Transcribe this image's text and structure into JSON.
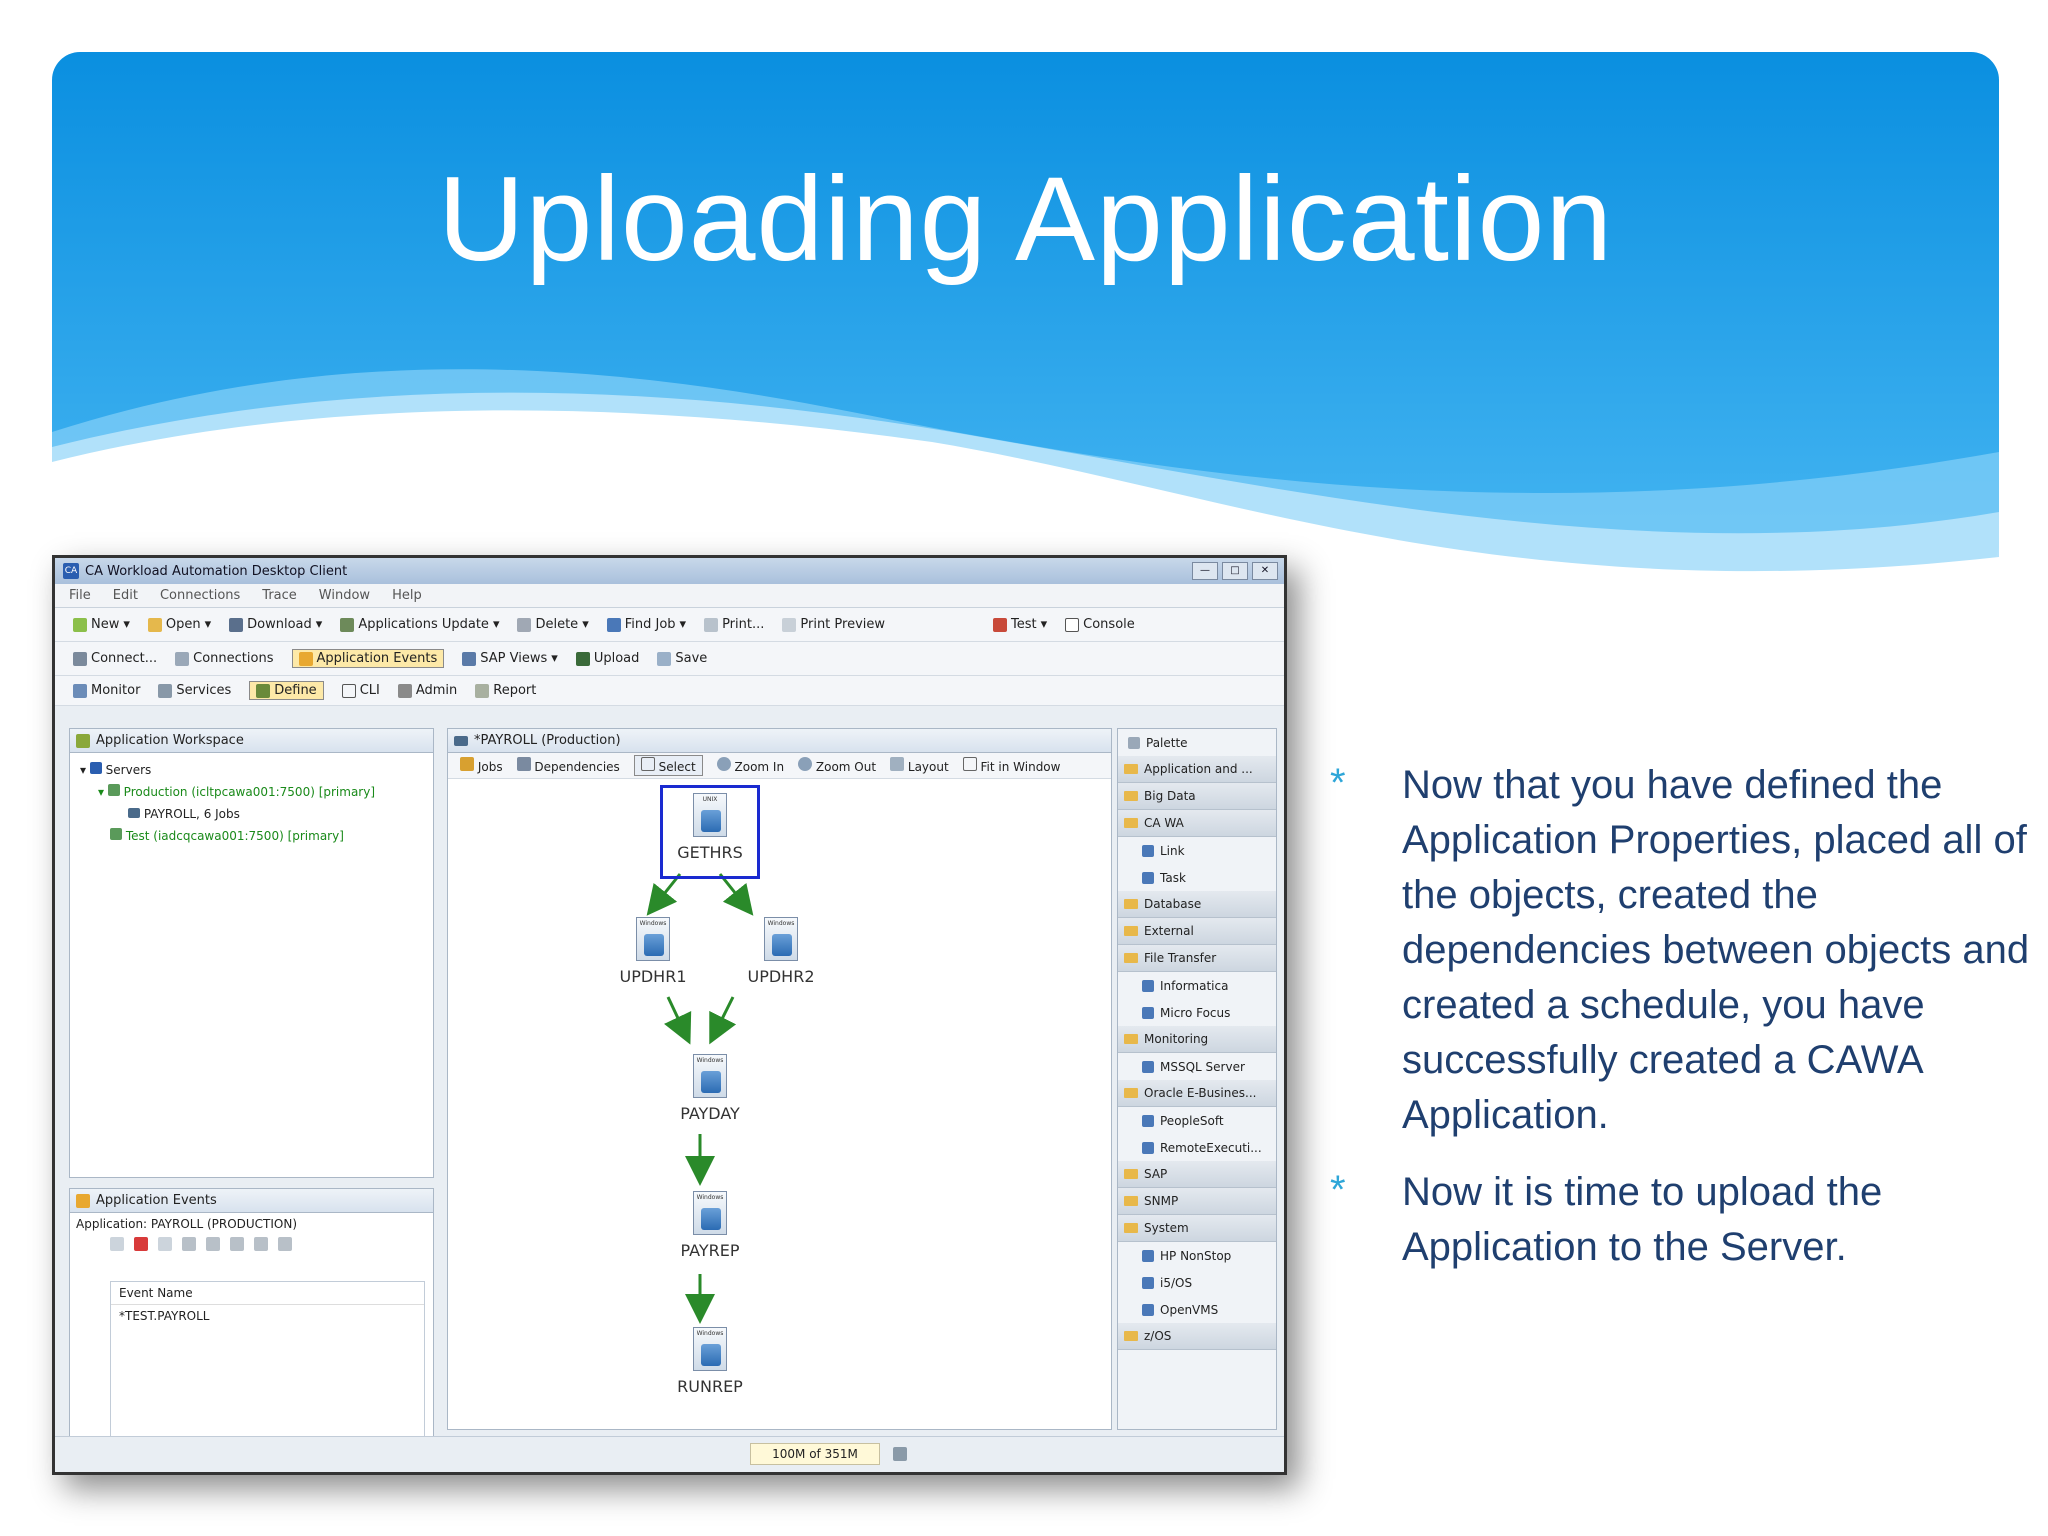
{
  "slide": {
    "title": "Uploading Application",
    "colors": {
      "banner_top": "#0a8fe0",
      "banner_bottom": "#46b6f2",
      "body_text": "#1f3f6f",
      "bullet_star": "#2ea6d8"
    },
    "bullets": [
      "Now that you have defined the Application Properties, placed all of the objects, created the dependencies between objects and created a schedule, you have successfully created a CAWA Application.",
      "Now it is time to upload the Application to the Server."
    ],
    "bullet_marker": "*"
  },
  "screenshot": {
    "window_title": "CA Workload Automation Desktop Client",
    "menu": [
      "File",
      "Edit",
      "Connections",
      "Trace",
      "Window",
      "Help"
    ],
    "toolbar1": [
      "New",
      "Open",
      "Download",
      "Applications Update",
      "Delete",
      "Find Job",
      "Print...",
      "Print Preview",
      "Test",
      "Console"
    ],
    "toolbar2": [
      "Connect...",
      "Connections",
      "Application Events",
      "SAP Views",
      "Upload",
      "Save"
    ],
    "toolbar3": [
      "Monitor",
      "Services",
      "Define",
      "CLI",
      "Admin",
      "Report"
    ],
    "workspace": {
      "title": "Application Workspace",
      "servers": "Servers",
      "production": "Production (icltpcawa001:7500) [primary]",
      "payroll": "PAYROLL, 6 Jobs",
      "test": "Test (iadcqcawa001:7500) [primary]"
    },
    "events": {
      "title": "Application Events",
      "application": "Application: PAYROLL (PRODUCTION)",
      "column": "Event Name",
      "row": "*TEST.PAYROLL"
    },
    "editor": {
      "tab": "*PAYROLL (Production)",
      "toolbar": [
        "Jobs",
        "Dependencies",
        "Select",
        "Zoom In",
        "Zoom Out",
        "Layout",
        "Fit in Window"
      ],
      "jobs": [
        {
          "name": "GETHRS",
          "type": "UNIX"
        },
        {
          "name": "UPDHR1",
          "type": "Windows"
        },
        {
          "name": "UPDHR2",
          "type": "Windows"
        },
        {
          "name": "PAYDAY",
          "type": "Windows"
        },
        {
          "name": "PAYREP",
          "type": "Windows"
        },
        {
          "name": "RUNREP",
          "type": "Windows"
        }
      ]
    },
    "palette": [
      {
        "label": "Palette",
        "kind": "header"
      },
      {
        "label": "Application and ...",
        "kind": "cat"
      },
      {
        "label": "Big Data",
        "kind": "cat"
      },
      {
        "label": "CA WA",
        "kind": "cat"
      },
      {
        "label": "Link",
        "kind": "sub"
      },
      {
        "label": "Task",
        "kind": "sub"
      },
      {
        "label": "Database",
        "kind": "cat"
      },
      {
        "label": "External",
        "kind": "cat"
      },
      {
        "label": "File Transfer",
        "kind": "cat"
      },
      {
        "label": "Informatica",
        "kind": "sub"
      },
      {
        "label": "Micro Focus",
        "kind": "sub"
      },
      {
        "label": "Monitoring",
        "kind": "cat"
      },
      {
        "label": "MSSQL Server",
        "kind": "sub"
      },
      {
        "label": "Oracle E-Busines...",
        "kind": "cat"
      },
      {
        "label": "PeopleSoft",
        "kind": "sub"
      },
      {
        "label": "RemoteExecuti...",
        "kind": "sub"
      },
      {
        "label": "SAP",
        "kind": "cat"
      },
      {
        "label": "SNMP",
        "kind": "cat"
      },
      {
        "label": "System",
        "kind": "cat"
      },
      {
        "label": "HP NonStop",
        "kind": "sub"
      },
      {
        "label": "i5/OS",
        "kind": "sub"
      },
      {
        "label": "OpenVMS",
        "kind": "sub"
      },
      {
        "label": "z/OS",
        "kind": "cat"
      }
    ],
    "status_memory": "100M of 351M"
  }
}
